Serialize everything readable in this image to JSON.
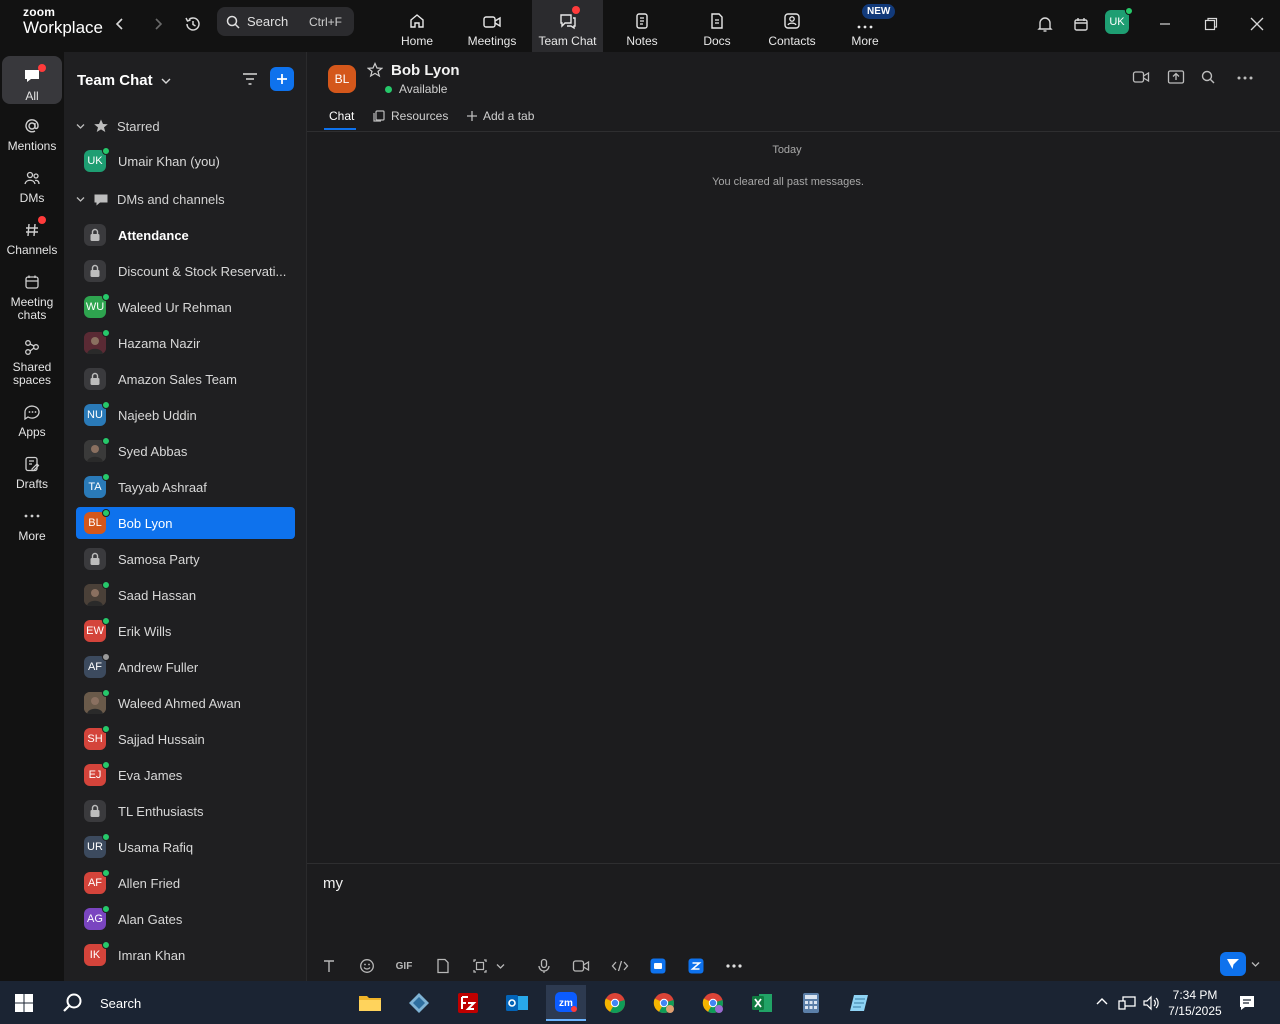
{
  "app": {
    "logo_line1": "zoom",
    "logo_line2": "Workplace"
  },
  "topbar": {
    "search_label": "Search",
    "search_shortcut": "Ctrl+F",
    "tabs": [
      {
        "label": "Home",
        "icon": "home-icon"
      },
      {
        "label": "Meetings",
        "icon": "video-camera-icon"
      },
      {
        "label": "Team Chat",
        "icon": "chat-bubbles-icon",
        "active": true
      },
      {
        "label": "Notes",
        "icon": "notes-icon"
      },
      {
        "label": "Docs",
        "icon": "docs-icon"
      },
      {
        "label": "Contacts",
        "icon": "contacts-icon"
      },
      {
        "label": "More",
        "icon": "more-dots-icon"
      }
    ],
    "new_badge": "NEW",
    "user_initials": "UK"
  },
  "rail": {
    "items": [
      {
        "label": "All",
        "icon": "chat-icon",
        "active": true
      },
      {
        "label": "Mentions",
        "icon": "at-icon"
      },
      {
        "label": "DMs",
        "icon": "people-icon"
      },
      {
        "label": "Channels",
        "icon": "hash-icon"
      },
      {
        "label": "Meeting chats",
        "icon": "calendar-icon"
      },
      {
        "label": "Shared spaces",
        "icon": "shared-spaces-icon"
      },
      {
        "label": "Apps",
        "icon": "apps-icon"
      },
      {
        "label": "Drafts",
        "icon": "drafts-icon"
      },
      {
        "label": "More",
        "icon": "more-dots-icon"
      }
    ]
  },
  "sidebar": {
    "title": "Team Chat",
    "starred_label": "Starred",
    "dms_label": "DMs and channels",
    "starred": [
      {
        "name": "Umair Khan (you)",
        "initials": "UK",
        "color": "#1e9e72"
      }
    ],
    "items": [
      {
        "name": "Attendance",
        "type": "channel",
        "bold": true
      },
      {
        "name": "Discount & Stock Reservati...",
        "type": "channel"
      },
      {
        "name": "Waleed Ur Rehman",
        "initials": "WU",
        "color": "#2ea44f"
      },
      {
        "name": "Hazama Nazir",
        "initials": "",
        "color": "#5a2a34"
      },
      {
        "name": "Amazon Sales Team",
        "type": "channel"
      },
      {
        "name": "Najeeb Uddin",
        "initials": "NU",
        "color": "#2a7ab8"
      },
      {
        "name": "Syed Abbas",
        "initials": "",
        "color": "#3a3a3a"
      },
      {
        "name": "Tayyab Ashraaf",
        "initials": "TA",
        "color": "#2a7ab8"
      },
      {
        "name": "Bob Lyon",
        "initials": "BL",
        "color": "#d4571b",
        "active": true
      },
      {
        "name": "Samosa Party",
        "type": "channel"
      },
      {
        "name": "Saad Hassan",
        "initials": "",
        "color": "#4a4038"
      },
      {
        "name": "Erik Wills",
        "initials": "EW",
        "color": "#d4443b"
      },
      {
        "name": "Andrew Fuller",
        "initials": "AF",
        "color": "#3c4a5e",
        "away": true
      },
      {
        "name": "Waleed Ahmed Awan",
        "initials": "",
        "color": "#6a5a4a"
      },
      {
        "name": "Sajjad Hussain",
        "initials": "SH",
        "color": "#d4443b"
      },
      {
        "name": "Eva James",
        "initials": "EJ",
        "color": "#d4443b"
      },
      {
        "name": "TL Enthusiasts",
        "type": "channel"
      },
      {
        "name": "Usama Rafiq",
        "initials": "UR",
        "color": "#3c4a5e"
      },
      {
        "name": "Allen Fried",
        "initials": "AF",
        "color": "#d4443b"
      },
      {
        "name": "Alan Gates",
        "initials": "AG",
        "color": "#7a45c0"
      },
      {
        "name": "Imran Khan",
        "initials": "IK",
        "color": "#d4443b"
      }
    ]
  },
  "conversation": {
    "initials": "BL",
    "name": "Bob Lyon",
    "status": "Available",
    "tabs": {
      "chat": "Chat",
      "resources": "Resources",
      "add": "Add a tab"
    },
    "date_divider": "Today",
    "system_message": "You cleared all past messages."
  },
  "composer": {
    "draft_text": "my",
    "gif_label": "GIF"
  },
  "taskbar": {
    "search_label": "Search",
    "time": "7:34 PM",
    "date": "7/15/2025"
  },
  "colors": {
    "accent": "#0e72ed",
    "online": "#26c86a",
    "notification": "#ff3b3b"
  }
}
